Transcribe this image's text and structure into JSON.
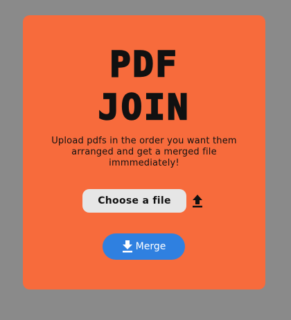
{
  "title": {
    "line1": "PDF",
    "line2": "JOIN"
  },
  "description": "Upload pdfs in the order you want them arranged and get a merged file immmediately!",
  "file_input": {
    "label": "Choose a file",
    "icon": "upload-icon"
  },
  "merge_button": {
    "label": "Merge",
    "icon": "download-icon"
  },
  "colors": {
    "background": "#8a8a8a",
    "card": "#f76b3c",
    "choose_button": "#e6e6e6",
    "merge_button": "#2f80e0"
  }
}
